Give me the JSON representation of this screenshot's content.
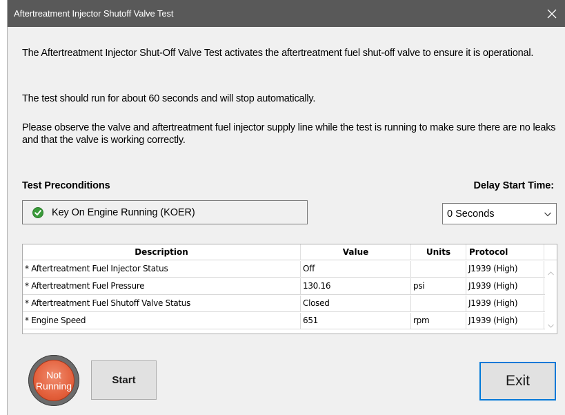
{
  "window": {
    "title": "Aftertreatment Injector Shutoff Valve Test"
  },
  "instructions": {
    "p1": "The Aftertreatment Injector Shut-Off Valve Test activates the aftertreatment fuel shut-off valve to ensure it is operational.",
    "p2": "The test should run for about 60 seconds and will stop automatically.",
    "p3": "Please observe the valve and aftertreatment fuel injector supply line while the test is running to make sure there are no leaks and that the valve is working correctly."
  },
  "preconditions": {
    "label": "Test Preconditions",
    "item": "Key On Engine Running (KOER)",
    "item_status_color": "#3a9b3a"
  },
  "delay": {
    "label": "Delay Start Time:",
    "selected": "0 Seconds"
  },
  "table": {
    "headers": [
      "Description",
      "Value",
      "Units",
      "Protocol"
    ],
    "rows": [
      {
        "description": "* Aftertreatment Fuel Injector Status",
        "value": "Off",
        "units": "",
        "protocol": "J1939 (High)"
      },
      {
        "description": "* Aftertreatment Fuel Pressure",
        "value": "130.16",
        "units": "psi",
        "protocol": "J1939 (High)"
      },
      {
        "description": "* Aftertreatment Fuel Shutoff Valve Status",
        "value": "Closed",
        "units": "",
        "protocol": "J1939 (High)"
      },
      {
        "description": "* Engine Speed",
        "value": "651",
        "units": "rpm",
        "protocol": "J1939 (High)"
      }
    ]
  },
  "status": {
    "line1": "Not",
    "line2": "Running",
    "color": "#e4613d"
  },
  "buttons": {
    "start": "Start",
    "exit": "Exit"
  },
  "colors": {
    "titlebar": "#595959",
    "accent": "#0078d7"
  }
}
